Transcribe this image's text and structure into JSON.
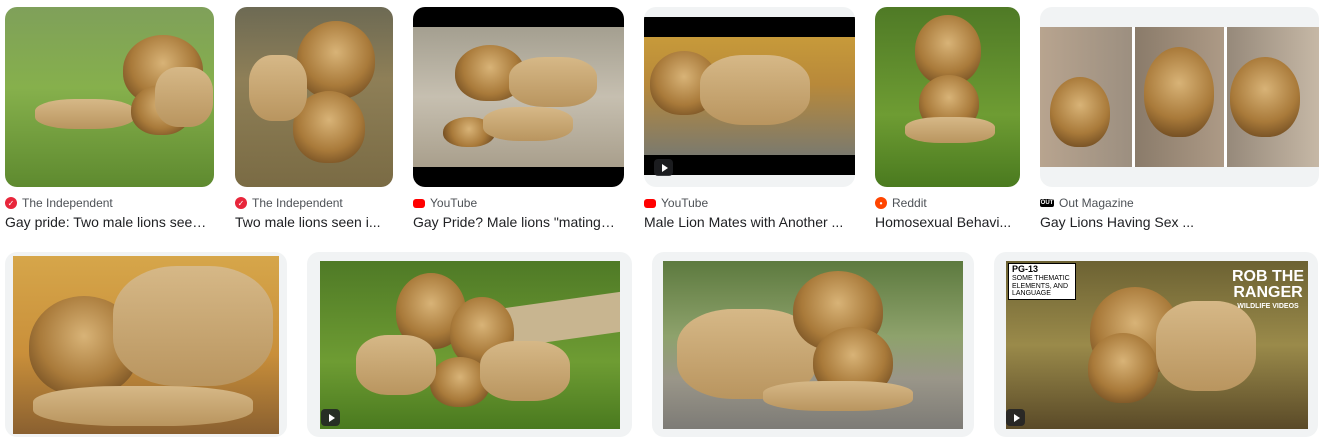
{
  "row1": [
    {
      "source": "The Independent",
      "favicon": "independent",
      "favicon_color": "#e8263b",
      "title": "Gay pride: Two male lions seen ...",
      "video": false
    },
    {
      "source": "The Independent",
      "favicon": "independent",
      "favicon_color": "#e8263b",
      "title": "Two male lions seen i...",
      "video": false
    },
    {
      "source": "YouTube",
      "favicon": "youtube",
      "favicon_color": "#ff0000",
      "title": "Gay Pride? Male lions \"mating\" ...",
      "video": false
    },
    {
      "source": "YouTube",
      "favicon": "youtube",
      "favicon_color": "#ff0000",
      "title": "Male Lion Mates with Another ...",
      "video": true
    },
    {
      "source": "Reddit",
      "favicon": "reddit",
      "favicon_color": "#ff4500",
      "title": "Homosexual Behavi...",
      "video": false
    },
    {
      "source": "Out Magazine",
      "favicon": "out",
      "favicon_color": "#000000",
      "favicon_text": "OUT",
      "title": "Gay Lions Having Sex ...",
      "video": false
    }
  ],
  "row2": [
    {
      "video": false
    },
    {
      "video": true
    },
    {
      "video": false
    },
    {
      "video": true,
      "overlay_title": "ROB THE RANGER",
      "overlay_sub": "WILDLIFE VIDEOS",
      "rating": "PG-13",
      "rating_note": "SOME THEMATIC ELEMENTS, AND LANGUAGE"
    }
  ]
}
